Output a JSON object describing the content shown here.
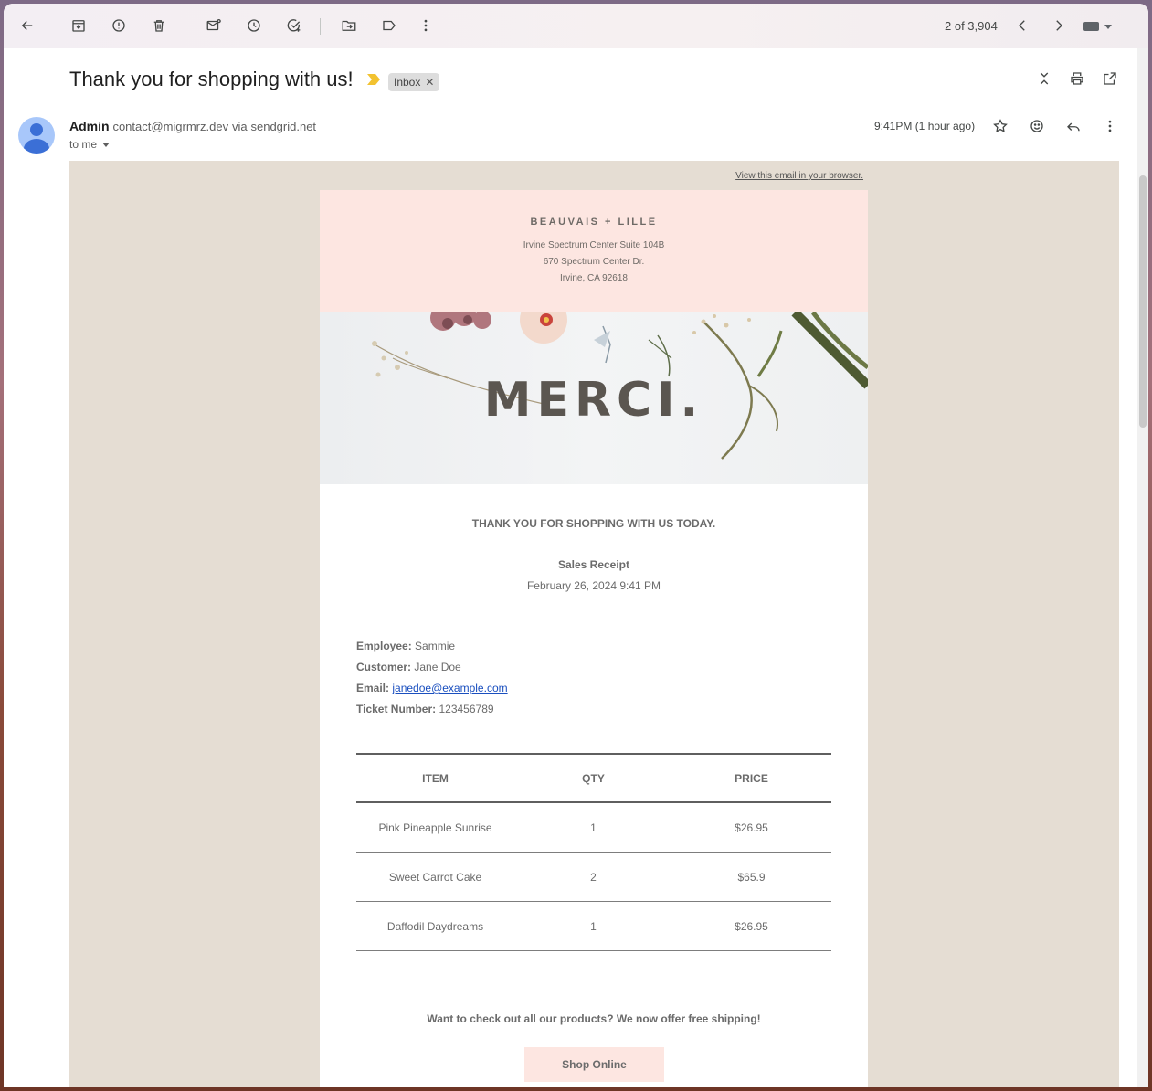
{
  "toolbar": {
    "icons": [
      "back-arrow-icon",
      "archive-icon",
      "report-spam-icon",
      "delete-icon",
      "mark-unread-icon",
      "snooze-icon",
      "add-to-tasks-icon",
      "move-to-icon",
      "labels-icon",
      "more-vert-icon"
    ],
    "pager": "2 of 3,904"
  },
  "email": {
    "subject": "Thank you for shopping with us!",
    "label_chip": "Inbox",
    "sender_name": "Admin",
    "sender_address": "contact@migrmrz.dev",
    "via_label": "via",
    "via_domain": "sendgrid.net",
    "recipient": "to me",
    "time": "9:41PM (1 hour ago)"
  },
  "body": {
    "view_in_browser": "View this email in your browser.",
    "brand_name": "BEAUVAIS + LILLE",
    "address_lines": [
      "Irvine Spectrum Center Suite 104B",
      "670 Spectrum Center Dr.",
      "Irvine, CA 92618"
    ],
    "hero_text": "MERCI.",
    "thanks_heading": "THANK YOU FOR SHOPPING WITH US TODAY.",
    "receipt_title": "Sales Receipt",
    "receipt_date": "February 26, 2024 9:41 PM",
    "info": {
      "employee_label": "Employee:",
      "employee": "Sammie",
      "customer_label": "Customer:",
      "customer": "Jane Doe",
      "email_label": "Email:",
      "email": "janedoe@example.com",
      "ticket_label": "Ticket Number:",
      "ticket": "123456789"
    },
    "table": {
      "headers": [
        "ITEM",
        "QTY",
        "PRICE"
      ],
      "rows": [
        [
          "Pink Pineapple Sunrise",
          "1",
          "$26.95"
        ],
        [
          "Sweet Carrot Cake",
          "2",
          "$65.9"
        ],
        [
          "Daffodil Daydreams",
          "1",
          "$26.95"
        ]
      ]
    },
    "promo_text": "Want to check out all our products? We now offer free shipping!",
    "shop_button": "Shop Online"
  },
  "colors": {
    "email_background": "#e5ddd3",
    "brand_header": "#fde6e1",
    "text_gray": "#6b6b6b",
    "link_blue": "#1a4fbf",
    "important_marker": "#f2c230"
  }
}
